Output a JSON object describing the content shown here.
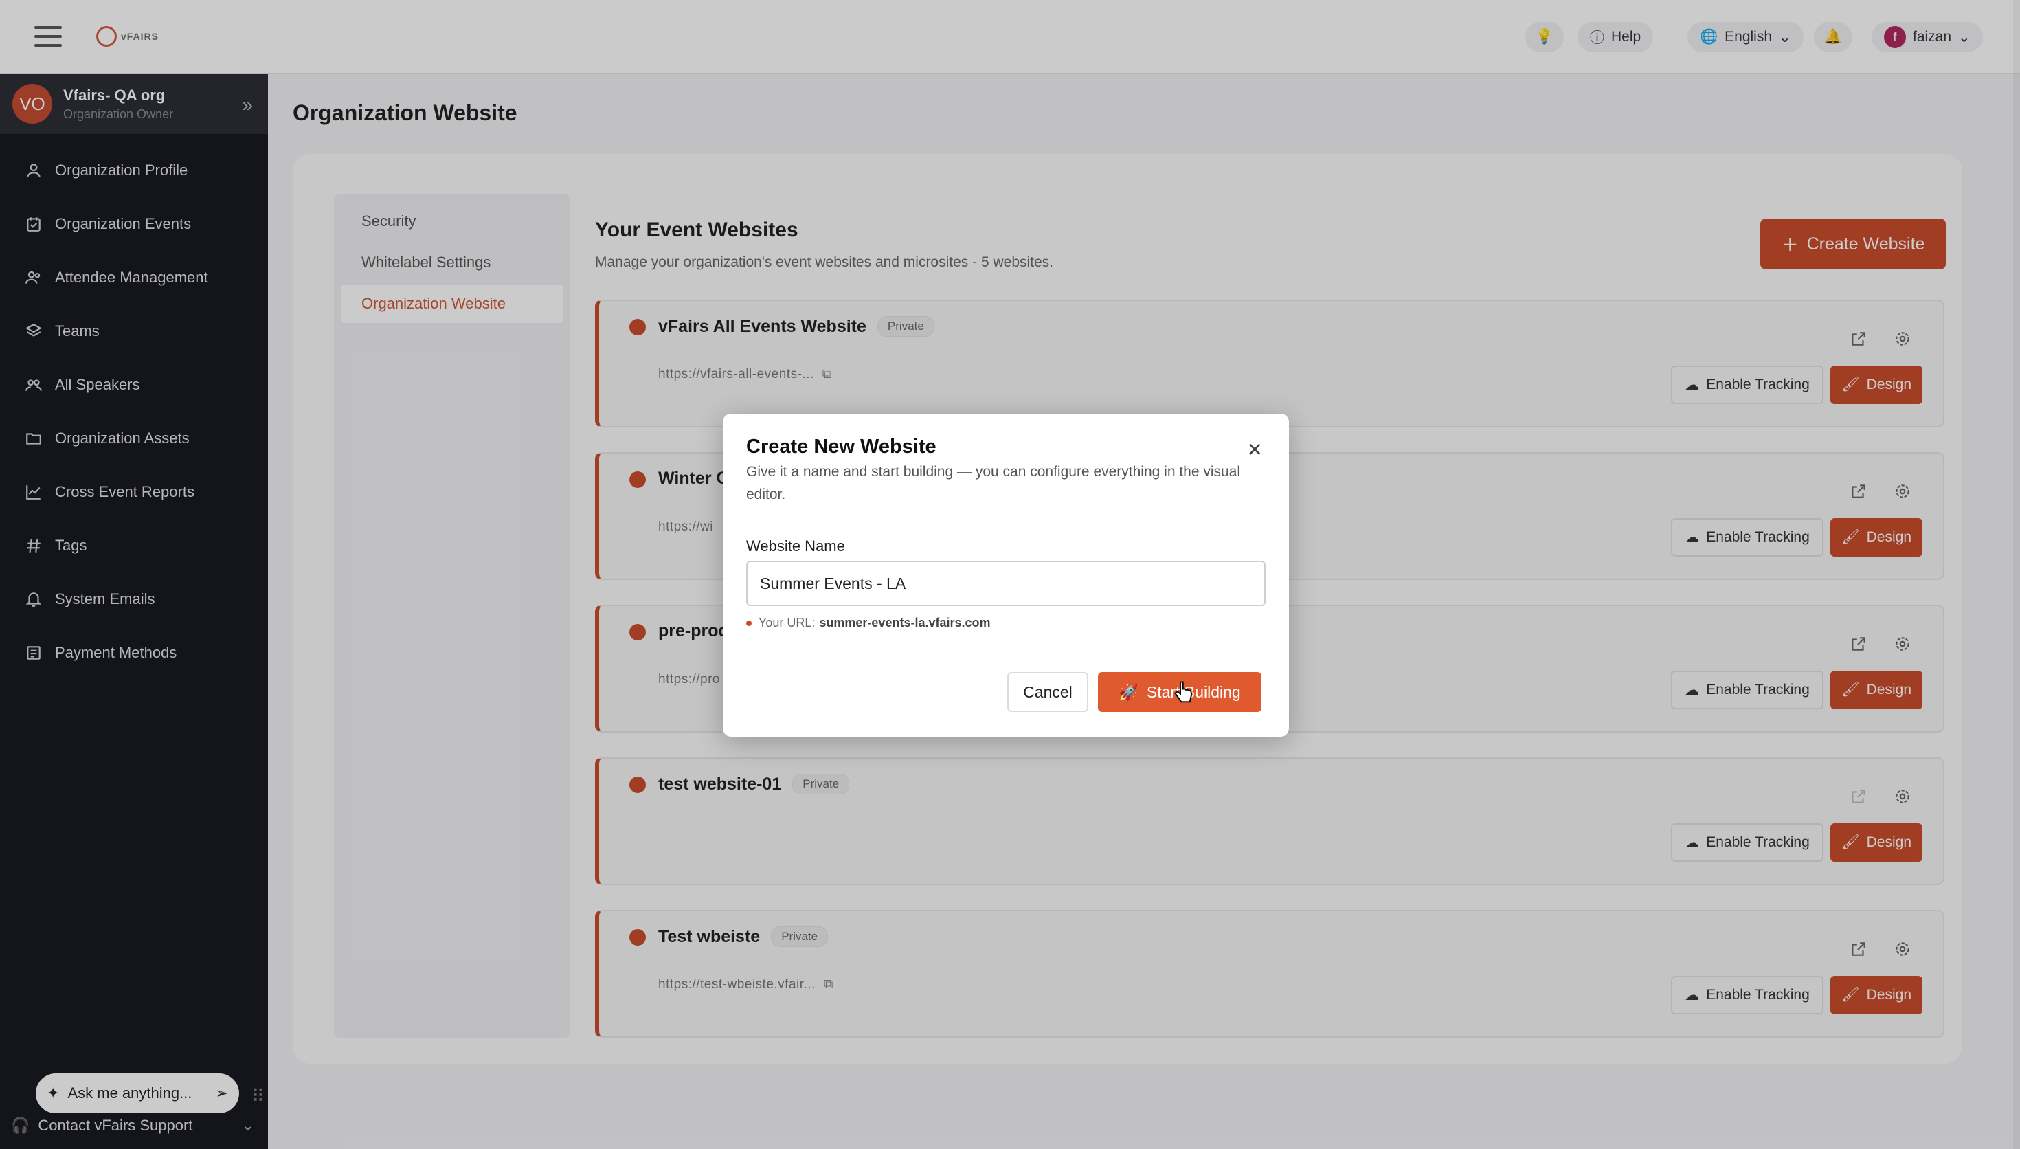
{
  "header": {
    "logo_text": "vFAIRS",
    "help_label": "Help",
    "language_label": "English",
    "user_initial": "f",
    "user_name": "faizan"
  },
  "org": {
    "avatar_initials": "VO",
    "name": "Vfairs- QA org",
    "role": "Organization Owner"
  },
  "sidebar": {
    "items": [
      {
        "label": "Organization Profile",
        "icon": "user-icon"
      },
      {
        "label": "Organization Events",
        "icon": "calendar-check-icon"
      },
      {
        "label": "Attendee Management",
        "icon": "users-icon"
      },
      {
        "label": "Teams",
        "icon": "layers-icon"
      },
      {
        "label": "All Speakers",
        "icon": "speakers-icon"
      },
      {
        "label": "Organization Assets",
        "icon": "folder-icon"
      },
      {
        "label": "Cross Event Reports",
        "icon": "line-chart-icon"
      },
      {
        "label": "Tags",
        "icon": "hash-icon"
      },
      {
        "label": "System Emails",
        "icon": "bell-icon"
      },
      {
        "label": "Payment Methods",
        "icon": "receipt-icon"
      }
    ],
    "ask_placeholder": "Ask me anything...",
    "support_label": "Contact vFairs Support"
  },
  "page": {
    "title": "Organization Website"
  },
  "subnav": {
    "items": [
      "Security",
      "Whitelabel Settings",
      "Organization Website"
    ],
    "active": "Organization Website"
  },
  "websites": {
    "title": "Your Event Websites",
    "subtitle": "Manage your organization's event websites and microsites - 5 websites.",
    "create_label": "Create Website",
    "enable_tracking_label": "Enable Tracking",
    "design_label": "Design",
    "items": [
      {
        "name": "vFairs All Events Website",
        "badge": "Private",
        "url": "https://vfairs-all-events-..."
      },
      {
        "name": "Winter C",
        "badge": "",
        "url": "https://wi"
      },
      {
        "name": "pre-prod",
        "badge": "",
        "url": "https://pro"
      },
      {
        "name": "test website-01",
        "badge": "Private",
        "url": ""
      },
      {
        "name": "Test wbeiste",
        "badge": "Private",
        "url": "https://test-wbeiste.vfair..."
      }
    ]
  },
  "modal": {
    "title": "Create New Website",
    "description": "Give it a name and start building — you can configure everything in the visual editor.",
    "field_label": "Website Name",
    "field_value": "Summer Events - LA",
    "url_label": "Your URL:",
    "url_value": "summer-events-la.vfairs.com",
    "cancel_label": "Cancel",
    "start_label": "Start Building"
  },
  "colors": {
    "accent": "#c94a27",
    "sidebar_bg": "#15171c"
  }
}
